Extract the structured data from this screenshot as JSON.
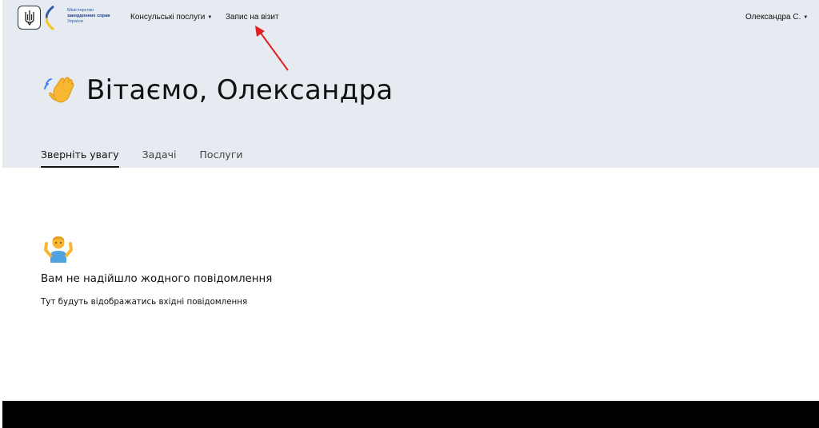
{
  "header": {
    "logo": {
      "line1": "Міністерство",
      "line2": "закордонних справ",
      "line3": "України"
    },
    "nav": {
      "consular_services": "Консульські послуги",
      "appointment": "Запис на візит",
      "user_name": "Олександра С."
    }
  },
  "hero": {
    "greeting": "Вітаємо, Олександра"
  },
  "tabs": [
    {
      "label": "Зверніть увагу",
      "active": true
    },
    {
      "label": "Задачі",
      "active": false
    },
    {
      "label": "Послуги",
      "active": false
    }
  ],
  "empty_state": {
    "title": "Вам не надійшло жодного повідомлення",
    "description": "Тут будуть відображатись вхідні повідомлення"
  },
  "colors": {
    "header_bg": "#e5ebf1",
    "footer_bg": "#000000",
    "annotation_arrow": "#e02020",
    "logo_blue": "#2d5aa8",
    "logo_yellow": "#f5c518"
  }
}
